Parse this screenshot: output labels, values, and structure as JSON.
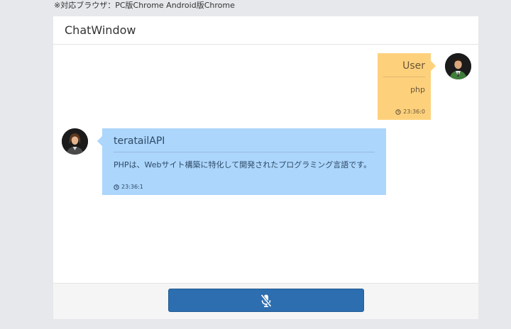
{
  "notice": "※対応ブラウザ：PC版Chrome Android版Chrome",
  "window": {
    "title": "ChatWindow"
  },
  "messages": [
    {
      "sender": "User",
      "text": "php",
      "time": "23:36:0",
      "side": "right",
      "color": "#fdd17c"
    },
    {
      "sender": "teratailAPI",
      "text": "PHPは、Webサイト構築に特化して開発されたプログラミング言語です。",
      "time": "23:36:1",
      "side": "left",
      "color": "#acd6fc"
    }
  ],
  "icons": {
    "clock": "clock-icon",
    "mic": "mic-off-icon"
  },
  "colors": {
    "accent": "#2c6eaf",
    "user_bubble": "#fdd17c",
    "api_bubble": "#acd6fc"
  }
}
